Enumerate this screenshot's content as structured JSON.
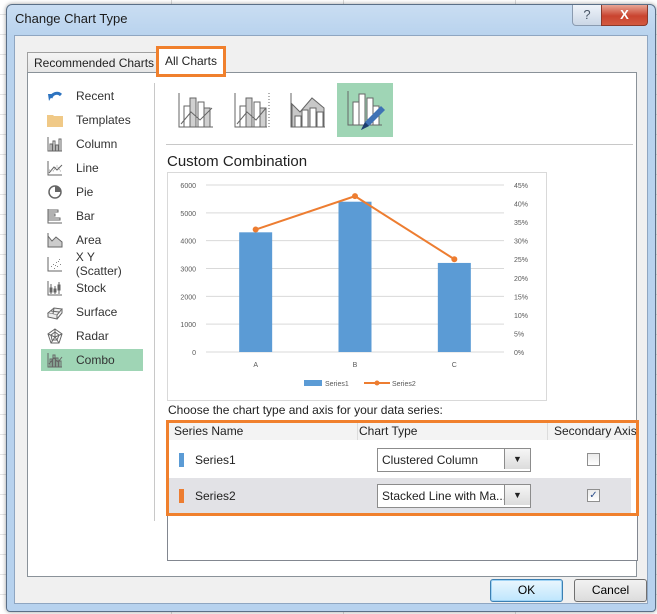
{
  "window": {
    "title": "Change Chart Type",
    "help_glyph": "?",
    "close_glyph": "X"
  },
  "tabs": [
    {
      "label": "Recommended Charts",
      "active": false
    },
    {
      "label": "All Charts",
      "active": true
    }
  ],
  "sidebar": {
    "items": [
      {
        "label": "Recent",
        "icon": "recent-icon"
      },
      {
        "label": "Templates",
        "icon": "folder-icon"
      },
      {
        "label": "Column",
        "icon": "column-chart-icon"
      },
      {
        "label": "Line",
        "icon": "line-chart-icon"
      },
      {
        "label": "Pie",
        "icon": "pie-chart-icon"
      },
      {
        "label": "Bar",
        "icon": "bar-chart-icon"
      },
      {
        "label": "Area",
        "icon": "area-chart-icon"
      },
      {
        "label": "X Y (Scatter)",
        "icon": "scatter-chart-icon"
      },
      {
        "label": "Stock",
        "icon": "stock-chart-icon"
      },
      {
        "label": "Surface",
        "icon": "surface-chart-icon"
      },
      {
        "label": "Radar",
        "icon": "radar-chart-icon"
      },
      {
        "label": "Combo",
        "icon": "combo-chart-icon",
        "active": true
      }
    ]
  },
  "subtypes": [
    {
      "name": "clustered-column-line-icon"
    },
    {
      "name": "clustered-column-line-secondary-axis-icon"
    },
    {
      "name": "stacked-area-clustered-column-icon"
    },
    {
      "name": "custom-combination-icon",
      "active": true
    }
  ],
  "section_title": "Custom Combination",
  "chart_data": {
    "type": "bar",
    "categories": [
      "A",
      "B",
      "C"
    ],
    "series": [
      {
        "name": "Series1",
        "kind": "column",
        "axis": "primary",
        "color": "#5b9bd5",
        "values": [
          4300,
          5400,
          3200
        ]
      },
      {
        "name": "Series2",
        "kind": "line-markers",
        "axis": "secondary",
        "color": "#ed7d31",
        "values": [
          0.33,
          0.42,
          0.25
        ]
      }
    ],
    "y_primary": {
      "min": 0,
      "max": 6000,
      "ticks": [
        "0",
        "1000",
        "2000",
        "3000",
        "4000",
        "5000",
        "6000"
      ]
    },
    "y_secondary": {
      "min": 0,
      "max": 0.45,
      "ticks": [
        "0%",
        "5%",
        "10%",
        "15%",
        "20%",
        "25%",
        "30%",
        "35%",
        "40%",
        "45%"
      ]
    },
    "grid": true,
    "legend": "bottom",
    "legend_entries": [
      "Series1",
      "Series2"
    ]
  },
  "series_section": {
    "prompt": "Choose the chart type and axis for your data series:",
    "headers": {
      "name": "Series Name",
      "type": "Chart Type",
      "secondary": "Secondary Axis"
    },
    "rows": [
      {
        "name": "Series1",
        "color": "#5b9bd5",
        "chart_type": "Clustered Column",
        "secondary_axis": false
      },
      {
        "name": "Series2",
        "color": "#ed7d31",
        "chart_type": "Stacked Line with Ma...",
        "secondary_axis": true
      }
    ],
    "check_glyph": "✓",
    "dropdown_glyph": "▼"
  },
  "buttons": {
    "ok": "OK",
    "cancel": "Cancel"
  }
}
